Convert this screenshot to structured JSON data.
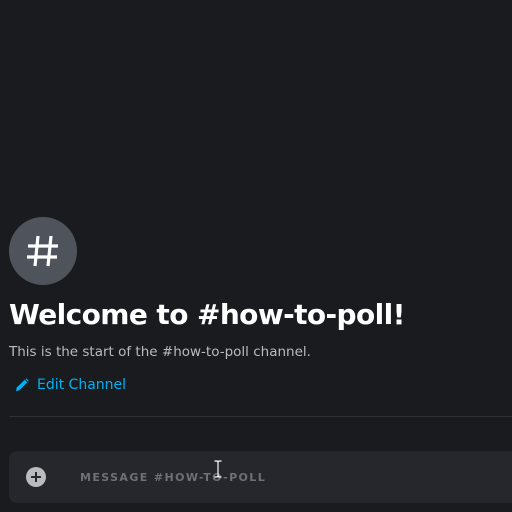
{
  "channel": {
    "icon": "hashtag-icon",
    "welcome_title": "Welcome to #how-to-poll!",
    "welcome_subtitle": "This is the start of the #how-to-poll channel.",
    "edit_label": "Edit Channel",
    "edit_icon": "pencil-icon"
  },
  "composer": {
    "placeholder": "MESSAGE #HOW-TO-POLL",
    "value": "",
    "attach_icon": "plus-circle-icon"
  },
  "colors": {
    "background": "#1a1b1f",
    "accent_link": "#00b0f4",
    "avatar_bg": "#4f545c",
    "composer_bg": "#25272c"
  }
}
